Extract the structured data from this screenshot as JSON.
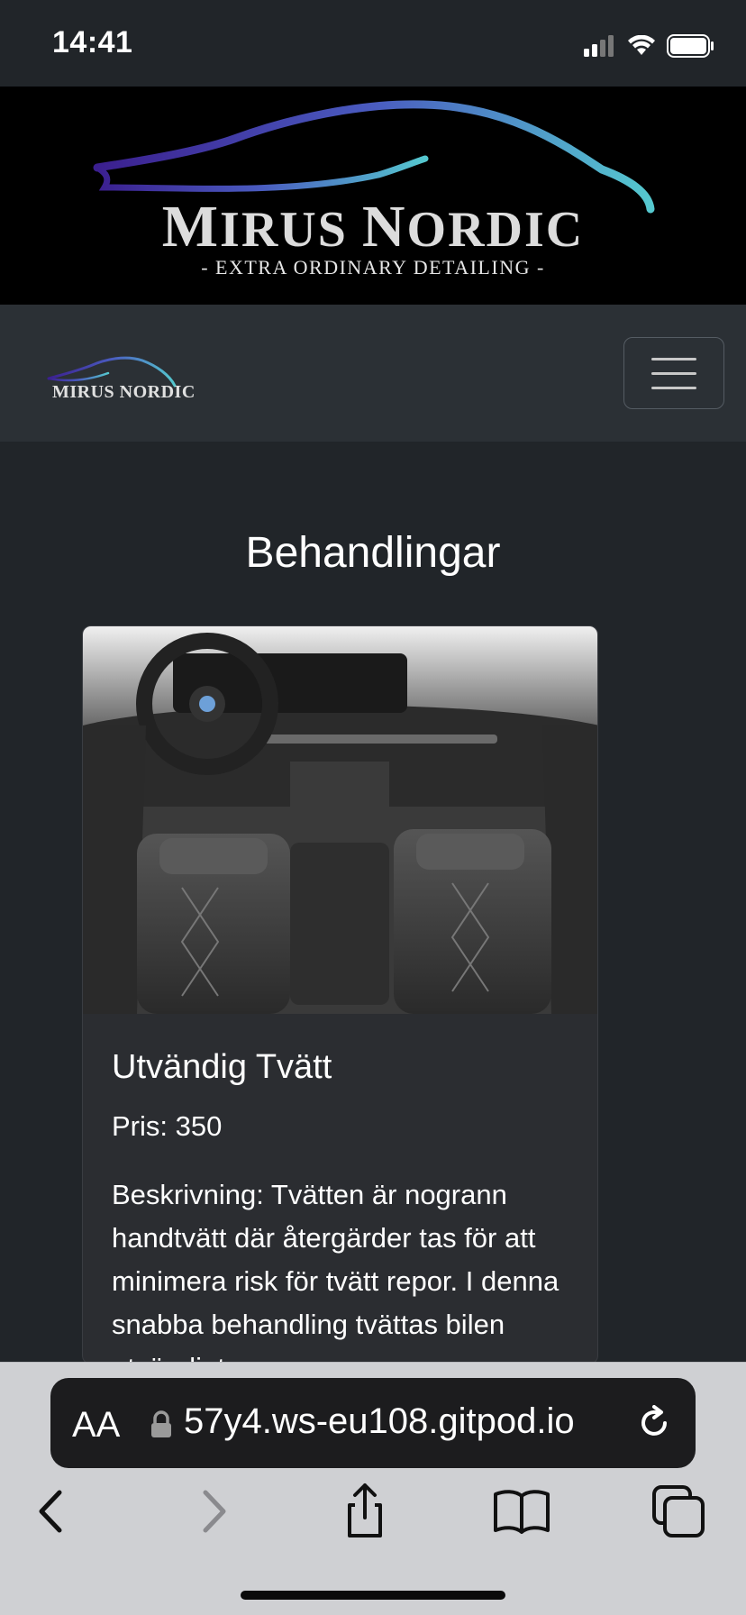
{
  "status_bar": {
    "time": "14:41"
  },
  "hero": {
    "title_big_m": "M",
    "title_rest_1": "IRUS ",
    "title_big_n": "N",
    "title_rest_2": "ORDIC",
    "tagline": "- EXTRA ORDINARY DETAILING -"
  },
  "navbar": {
    "logo_text": "MIRUS NORDIC",
    "toggler_label": "menu"
  },
  "main": {
    "section_title": "Behandlingar",
    "card": {
      "title": "Utvändig Tvätt",
      "price": "Pris: 350",
      "description": "Beskrivning: Tvätten är nogrann handtvätt där återgärder tas för att minimera risk för tvätt repor. I denna snabba behandling tvättas bilen utvändigt."
    }
  },
  "browser": {
    "aa_label": "AA",
    "url": "57y4.ws-eu108.gitpod.io"
  },
  "colors": {
    "page_bg": "#212529",
    "navbar_bg": "#2b3035",
    "card_bg": "#2b2d31",
    "accent_gradient_start": "#4b2aa8",
    "accent_gradient_end": "#4fc3c8"
  }
}
